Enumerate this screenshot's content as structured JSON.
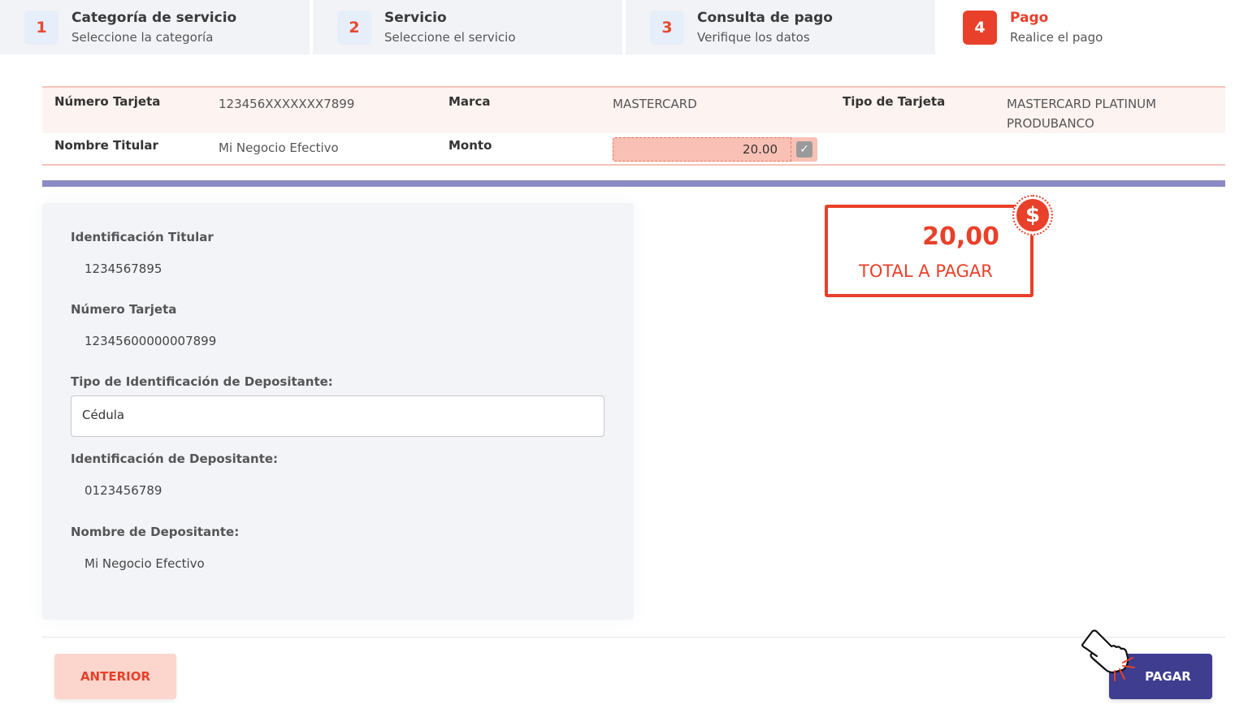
{
  "stepper": [
    {
      "num": "1",
      "title": "Categoría de servicio",
      "subtitle": "Seleccione la categoría"
    },
    {
      "num": "2",
      "title": "Servicio",
      "subtitle": "Seleccione el servicio"
    },
    {
      "num": "3",
      "title": "Consulta de pago",
      "subtitle": "Verifique los datos"
    },
    {
      "num": "4",
      "title": "Pago",
      "subtitle": "Realice el pago"
    }
  ],
  "info": {
    "card_number_label": "Número Tarjeta",
    "card_number_value": "123456XXXXXXX7899",
    "brand_label": "Marca",
    "brand_value": "MASTERCARD",
    "card_type_label": "Tipo de Tarjeta",
    "card_type_value": "MASTERCARD PLATINUM PRODUBANCO",
    "holder_label": "Nombre Titular",
    "holder_value": "Mi Negocio Efectivo",
    "amount_label": "Monto",
    "amount_value": "20.00"
  },
  "panel": {
    "holder_id_label": "Identificación Titular",
    "holder_id_value": "1234567895",
    "card_number_label": "Número Tarjeta",
    "card_number_value": "12345600000007899",
    "depositor_id_type_label": "Tipo de Identificación de Depositante:",
    "depositor_id_type_value": "Cédula",
    "depositor_id_label": "Identificación de Depositante:",
    "depositor_id_value": "0123456789",
    "depositor_name_label": "Nombre de Depositante:",
    "depositor_name_value": "Mi Negocio Efectivo"
  },
  "total": {
    "amount": "20,00",
    "label": "TOTAL A PAGAR",
    "badge": "$"
  },
  "buttons": {
    "previous": "ANTERIOR",
    "pay": "PAGAR"
  },
  "colors": {
    "accent": "#e8402a",
    "primary": "#3f3d8f",
    "divider": "#8b8cc4"
  }
}
